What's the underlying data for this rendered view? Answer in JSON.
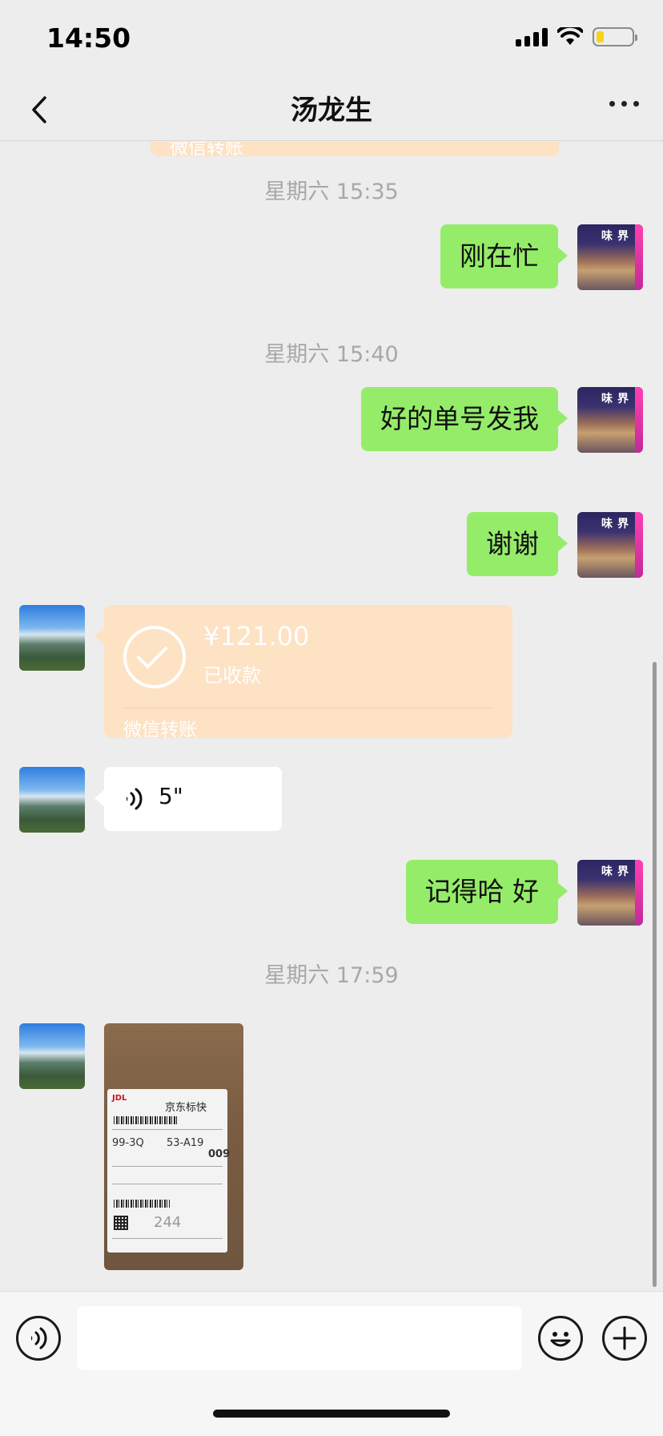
{
  "status": {
    "time": "14:50"
  },
  "nav": {
    "title": "汤龙生"
  },
  "chat": {
    "partial_transfer_label": "微信转账",
    "time1": "星期六 15:35",
    "msg1": "刚在忙",
    "time2": "星期六 15:40",
    "msg2": "好的单号发我",
    "msg3": "谢谢",
    "transfer": {
      "amount": "¥121.00",
      "status": "已收款",
      "label": "微信转账"
    },
    "voice": {
      "duration": "5\""
    },
    "msg4": "记得哈 好",
    "time3": "星期六 17:59",
    "photo": {
      "brand": "JDL",
      "title": "京东标快",
      "code1": "99-3Q",
      "code2": "53-A19",
      "code3": "009",
      "number": "244"
    },
    "self_avatar_sign": "味界"
  },
  "colors": {
    "background": "#ededed",
    "bubble_self": "#95ec69",
    "bubble_other": "#ffffff",
    "transfer": "#fde2c4"
  },
  "icons": [
    "back-arrow-icon",
    "more-icon",
    "check-icon",
    "voice-icon",
    "emoji-icon",
    "plus-icon"
  ]
}
